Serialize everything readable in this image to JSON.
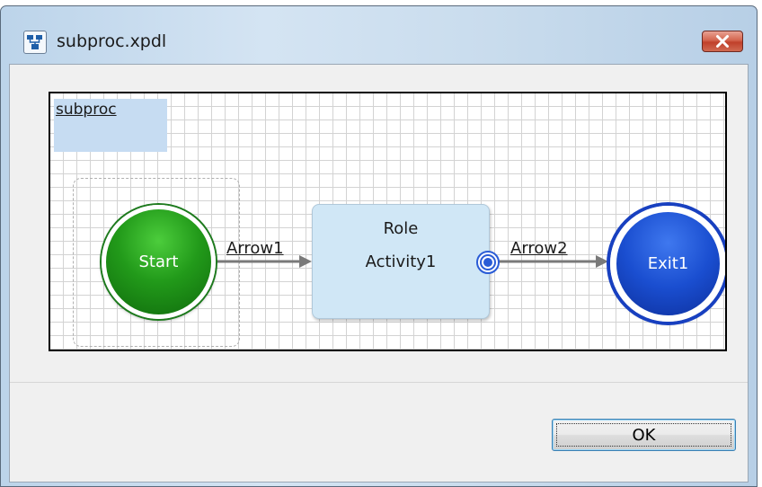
{
  "window": {
    "title": "subproc.xpdl",
    "icon": "xpdl-app-icon",
    "close_icon": "close-icon"
  },
  "canvas": {
    "pool_label": "subproc",
    "start_event": {
      "label": "Start",
      "color": "#229a1a"
    },
    "activity": {
      "role": "Role",
      "name": "Activity1",
      "color": "#d0e7f6"
    },
    "end_event": {
      "label": "Exit1",
      "color": "#1a4ed0"
    },
    "edges": [
      {
        "label": "Arrow1",
        "from": "Start",
        "to": "Activity1"
      },
      {
        "label": "Arrow2",
        "from": "Activity1",
        "to": "Exit1"
      }
    ]
  },
  "footer": {
    "ok_label": "OK"
  }
}
